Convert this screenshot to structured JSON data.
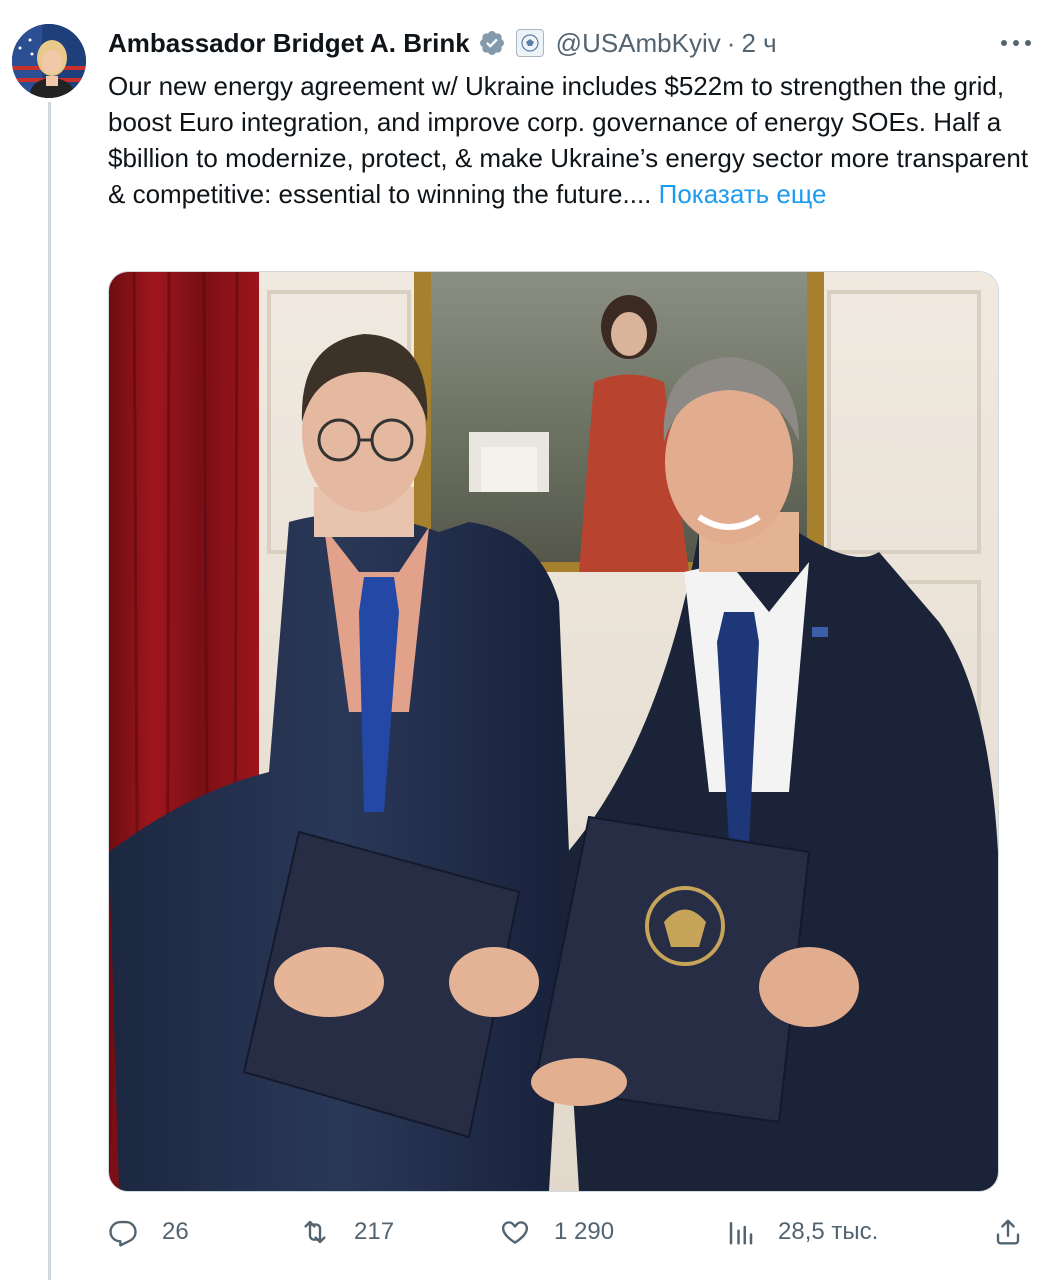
{
  "tweet": {
    "author_name": "Ambassador Bridget A. Brink",
    "handle": "@USAmbKyiv",
    "separator": "·",
    "time": "2 ч",
    "text": "Our new energy agreement w/ Ukraine includes $522m to strengthen the grid, boost Euro integration, and improve corp. governance of energy SOEs. Half a $billion to modernize, protect, & make Ukraine’s energy sector more transparent & competitive:  essential to winning the future....",
    "show_more": "Показать еще"
  },
  "icons": {
    "verified": "verified-badge-icon",
    "affiliation": "state-department-seal-icon",
    "more": "more-dots-icon",
    "reply": "reply-icon",
    "retweet": "retweet-icon",
    "like": "heart-icon",
    "views": "views-chart-icon",
    "share": "share-icon"
  },
  "stats": {
    "replies": "26",
    "retweets": "217",
    "likes": "1 290",
    "views": "28,5 тыс."
  },
  "colors": {
    "accent": "#1d9bf0",
    "text": "#0f1419",
    "secondary": "#536471"
  }
}
